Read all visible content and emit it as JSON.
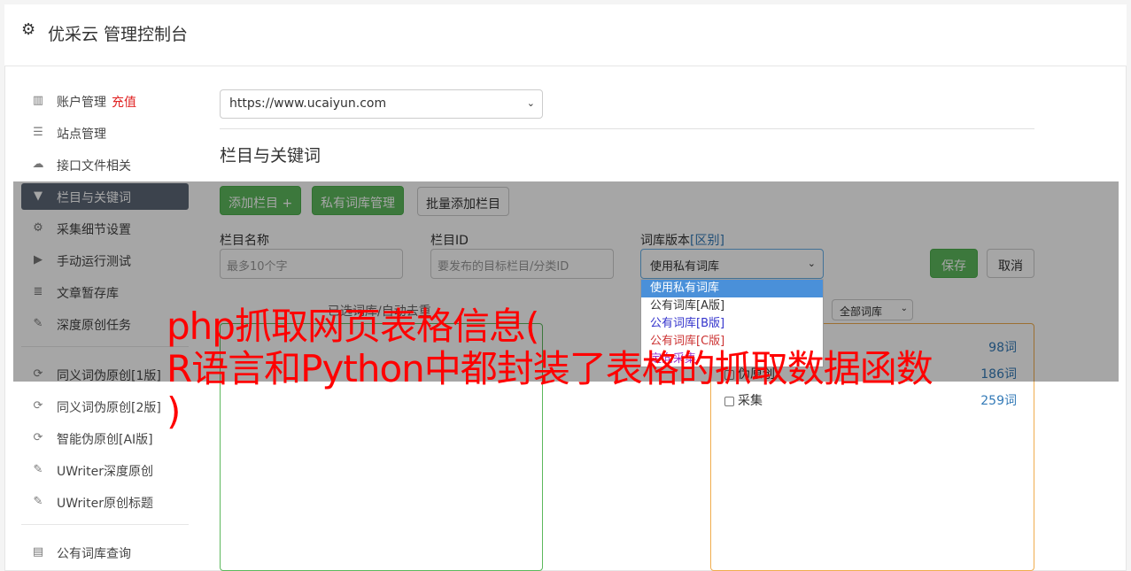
{
  "app": {
    "title": "优采云 管理控制台",
    "icon": "gear-icon"
  },
  "sidebar": {
    "items": [
      {
        "label": "账户管理",
        "badge": "充值",
        "icon": "bar-chart-icon"
      },
      {
        "label": "站点管理",
        "icon": "server-icon"
      },
      {
        "label": "接口文件相关",
        "icon": "cloud-upload-icon"
      },
      {
        "label": "栏目与关键词",
        "icon": "filter-icon",
        "active": true
      },
      {
        "label": "采集细节设置",
        "icon": "cogs-icon"
      },
      {
        "label": "手动运行测试",
        "icon": "play-circle-icon"
      },
      {
        "label": "文章暂存库",
        "icon": "database-icon"
      },
      {
        "label": "深度原创任务",
        "icon": "edit-icon"
      },
      {
        "label": "同义词伪原创[1版]",
        "icon": "refresh-icon"
      },
      {
        "label": "同义词伪原创[2版]",
        "icon": "refresh-icon"
      },
      {
        "label": "智能伪原创[AI版]",
        "icon": "refresh-icon"
      },
      {
        "label": "UWriter深度原创",
        "icon": "edit-icon"
      },
      {
        "label": "UWriter原创标题",
        "icon": "edit-icon"
      },
      {
        "label": "公有词库查询",
        "icon": "book-icon"
      }
    ]
  },
  "site_select": {
    "value": "https://www.ucaiyun.com"
  },
  "section": {
    "title": "栏目与关键词"
  },
  "buttons": {
    "add_column": "添加栏目 +",
    "private_lib": "私有词库管理",
    "batch_add": "批量添加栏目",
    "save": "保存",
    "cancel": "取消"
  },
  "form": {
    "name_label": "栏目名称",
    "name_placeholder": "最多10个字",
    "id_label": "栏目ID",
    "id_placeholder": "要发布的目标栏目/分类ID",
    "lib_label": "词库版本",
    "lib_label_link": "[区别]",
    "lib_value": "使用私有词库"
  },
  "dropdown": {
    "options": [
      {
        "label": "使用私有词库",
        "color": "#ffffff",
        "selected": true
      },
      {
        "label": "公有词库[A版]",
        "color": "#333333"
      },
      {
        "label": "公有词库[B版]",
        "color": "#3333cc"
      },
      {
        "label": "公有词库[C版]",
        "color": "#cc3333"
      },
      {
        "label": "定向采集",
        "color": "#9933cc"
      }
    ]
  },
  "hint": "已选词库/自动去重",
  "filter": {
    "value": "全部词库"
  },
  "library_rows": [
    {
      "label": "",
      "count": "98词"
    },
    {
      "label": "伪原创",
      "count": "186词"
    },
    {
      "label": "采集",
      "count": "259词"
    }
  ],
  "watermark": {
    "line1": "php抓取网页表格信息(",
    "line2": "R语言和Python中都封装了表格的抓取数据函数",
    "line3": ")"
  },
  "colors": {
    "accent_green": "#5cb85c",
    "active_nav": "#5c6777",
    "badge_red": "#e02020",
    "watermark_red": "#ff0000"
  }
}
